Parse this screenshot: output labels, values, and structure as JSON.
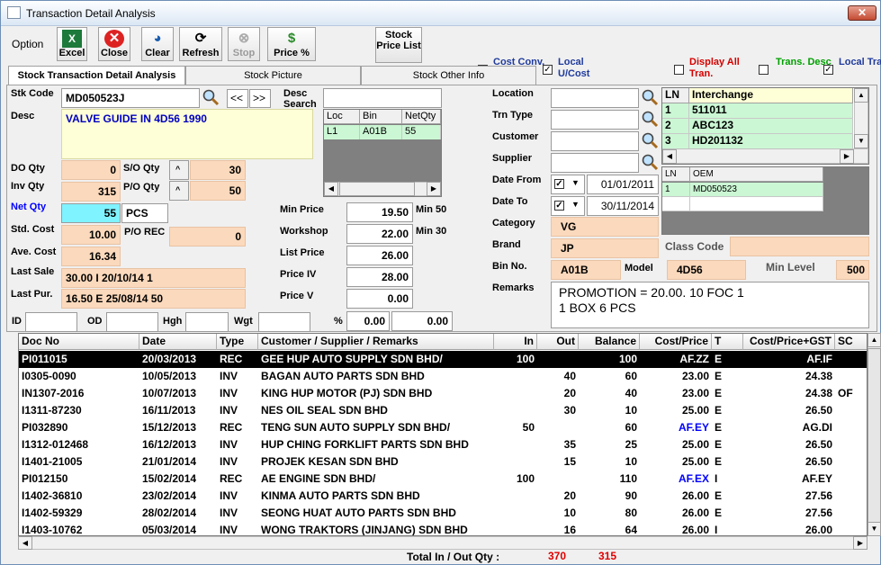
{
  "window": {
    "title": "Transaction Detail Analysis"
  },
  "toolbar": {
    "option": "Option",
    "excel": "Excel",
    "close": "Close",
    "clear": "Clear",
    "refresh": "Refresh",
    "stop": "Stop",
    "price": "Price %",
    "stock_price_list": "Stock Price List"
  },
  "checks": [
    {
      "label": "Cost Conv.",
      "checked": true,
      "color": "#1f3a9c"
    },
    {
      "label": "Local U/Cost",
      "checked": true,
      "color": "#1f3a9c"
    },
    {
      "label": "Display All Tran.",
      "checked": false,
      "color": "#d40000"
    },
    {
      "label": "Trans. Desc",
      "checked": false,
      "color": "#00a000"
    },
    {
      "label": "Local Trans",
      "checked": true,
      "color": "#1f3a9c"
    }
  ],
  "tabs": [
    "Stock Transaction Detail Analysis",
    "Stock Picture",
    "Stock Other Info"
  ],
  "left": {
    "stk_code_label": "Stk Code",
    "stk_code": "MD050523J",
    "nav_prev": "<<",
    "nav_next": ">>",
    "desc_label": "Desc",
    "desc": "VALVE GUIDE IN  4D56 1990",
    "desc_search_label": "Desc Search",
    "do_qty_label": "DO Qty",
    "do_qty": "0",
    "so_qty_label": "S/O Qty",
    "so_qty": "30",
    "inv_qty_label": "Inv Qty",
    "inv_qty": "315",
    "po_qty_label": "P/O Qty",
    "po_qty": "50",
    "net_qty_label": "Net Qty",
    "net_qty": "55",
    "uom": "PCS",
    "std_cost_label": "Std. Cost",
    "std_cost": "10.00",
    "po_rec_label": "P/O REC",
    "po_rec": "0",
    "ave_cost_label": "Ave. Cost",
    "ave_cost": "16.34",
    "last_sale_label": "Last Sale",
    "last_sale": "30.00 I   20/10/14   1",
    "last_pur_label": "Last Pur.",
    "last_pur": "16.50 E   25/08/14   50",
    "id_label": "ID",
    "od_label": "OD",
    "hgh_label": "Hgh",
    "wgt_label": "Wgt",
    "pct_label": "%",
    "pct1": "0.00",
    "pct2": "0.00"
  },
  "loc_grid": {
    "headers": [
      "Loc",
      "Bin",
      "NetQty"
    ],
    "rows": [
      [
        "L1",
        "A01B",
        "55"
      ]
    ]
  },
  "prices": {
    "min_price_label": "Min Price",
    "min_price": "19.50",
    "min50": "Min 50",
    "workshop_label": "Workshop",
    "workshop": "22.00",
    "min30": "Min 30",
    "list_price_label": "List Price",
    "list_price": "26.00",
    "price_iv_label": "Price IV",
    "price_iv": "28.00",
    "price_v_label": "Price V",
    "price_v": "0.00"
  },
  "filters": {
    "location_label": "Location",
    "trn_type_label": "Trn Type",
    "customer_label": "Customer",
    "supplier_label": "Supplier",
    "date_from_label": "Date From",
    "date_from": "01/01/2011",
    "date_to_label": "Date To",
    "date_to": "30/11/2014",
    "category_label": "Category",
    "category": "VG",
    "brand_label": "Brand",
    "brand": "JP",
    "bin_label": "Bin No.",
    "bin": "A01B",
    "model_label": "Model",
    "model": "4D56",
    "class_code_label": "Class Code",
    "min_level_label": "Min Level",
    "min_level": "500",
    "remarks_label": "Remarks",
    "remarks_line1": "PROMOTION = 20.00. 10 FOC 1",
    "remarks_line2": "1 BOX 6 PCS"
  },
  "interchange": {
    "headers": [
      "LN",
      "Interchange"
    ],
    "rows": [
      [
        "1",
        "511011"
      ],
      [
        "2",
        "ABC123"
      ],
      [
        "3",
        "HD201132"
      ]
    ]
  },
  "oem": {
    "headers": [
      "LN",
      "OEM"
    ],
    "rows": [
      [
        "1",
        "MD050523"
      ]
    ]
  },
  "table": {
    "headers": [
      "Doc No",
      "Date",
      "Type",
      "Customer / Supplier / Remarks",
      "In",
      "Out",
      "Balance",
      "Cost/Price",
      "T",
      "Cost/Price+GST",
      "SC"
    ],
    "rows": [
      [
        "PI011015",
        "20/03/2013",
        "REC",
        "GEE HUP AUTO SUPPLY SDN BHD/",
        "100",
        "",
        "100",
        "AF.ZZ",
        "E",
        "AF.IF",
        ""
      ],
      [
        "I0305-0090",
        "10/05/2013",
        "INV",
        "BAGAN AUTO PARTS SDN BHD",
        "",
        "40",
        "60",
        "23.00",
        "E",
        "24.38",
        ""
      ],
      [
        "IN1307-2016",
        "10/07/2013",
        "INV",
        "KING HUP MOTOR (PJ) SDN BHD",
        "",
        "20",
        "40",
        "23.00",
        "E",
        "24.38",
        "OF"
      ],
      [
        "I1311-87230",
        "16/11/2013",
        "INV",
        "NES OIL SEAL SDN BHD",
        "",
        "30",
        "10",
        "25.00",
        "E",
        "26.50",
        ""
      ],
      [
        "PI032890",
        "15/12/2013",
        "REC",
        "TENG SUN AUTO SUPPLY SDN BHD/",
        "50",
        "",
        "60",
        "AF.EY",
        "E",
        "AG.DI",
        ""
      ],
      [
        "I1312-012468",
        "16/12/2013",
        "INV",
        "HUP CHING FORKLIFT PARTS SDN BHD",
        "",
        "35",
        "25",
        "25.00",
        "E",
        "26.50",
        ""
      ],
      [
        "I1401-21005",
        "21/01/2014",
        "INV",
        "PROJEK KESAN SDN BHD",
        "",
        "15",
        "10",
        "25.00",
        "E",
        "26.50",
        ""
      ],
      [
        "PI012150",
        "15/02/2014",
        "REC",
        "AE ENGINE SDN BHD/",
        "100",
        "",
        "110",
        "AF.EX",
        "I",
        "AF.EY",
        ""
      ],
      [
        "I1402-36810",
        "23/02/2014",
        "INV",
        "KINMA AUTO PARTS SDN BHD",
        "",
        "20",
        "90",
        "26.00",
        "E",
        "27.56",
        ""
      ],
      [
        "I1402-59329",
        "28/02/2014",
        "INV",
        "SEONG HUAT AUTO PARTS SDN BHD",
        "",
        "10",
        "80",
        "26.00",
        "E",
        "27.56",
        ""
      ],
      [
        "I1403-10762",
        "05/03/2014",
        "INV",
        "WONG TRAKTORS (JINJANG) SDN BHD",
        "",
        "16",
        "64",
        "26.00",
        "I",
        "26.00",
        ""
      ]
    ],
    "blue_cost_rows": [
      4,
      7
    ]
  },
  "footer": {
    "label": "Total In / Out Qty :",
    "total_in": "370",
    "total_out": "315"
  }
}
